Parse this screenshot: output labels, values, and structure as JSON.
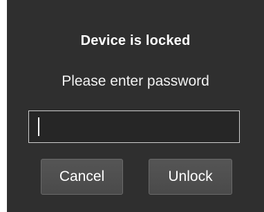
{
  "dialog": {
    "title": "Device is locked",
    "prompt": "Please enter password",
    "password_value": "",
    "cancel_label": "Cancel",
    "unlock_label": "Unlock"
  },
  "colors": {
    "dialog_background": "#2f2f2f",
    "text": "#ffffff",
    "input_border": "#cfcfcf",
    "button_background": "#4e4e4e"
  }
}
